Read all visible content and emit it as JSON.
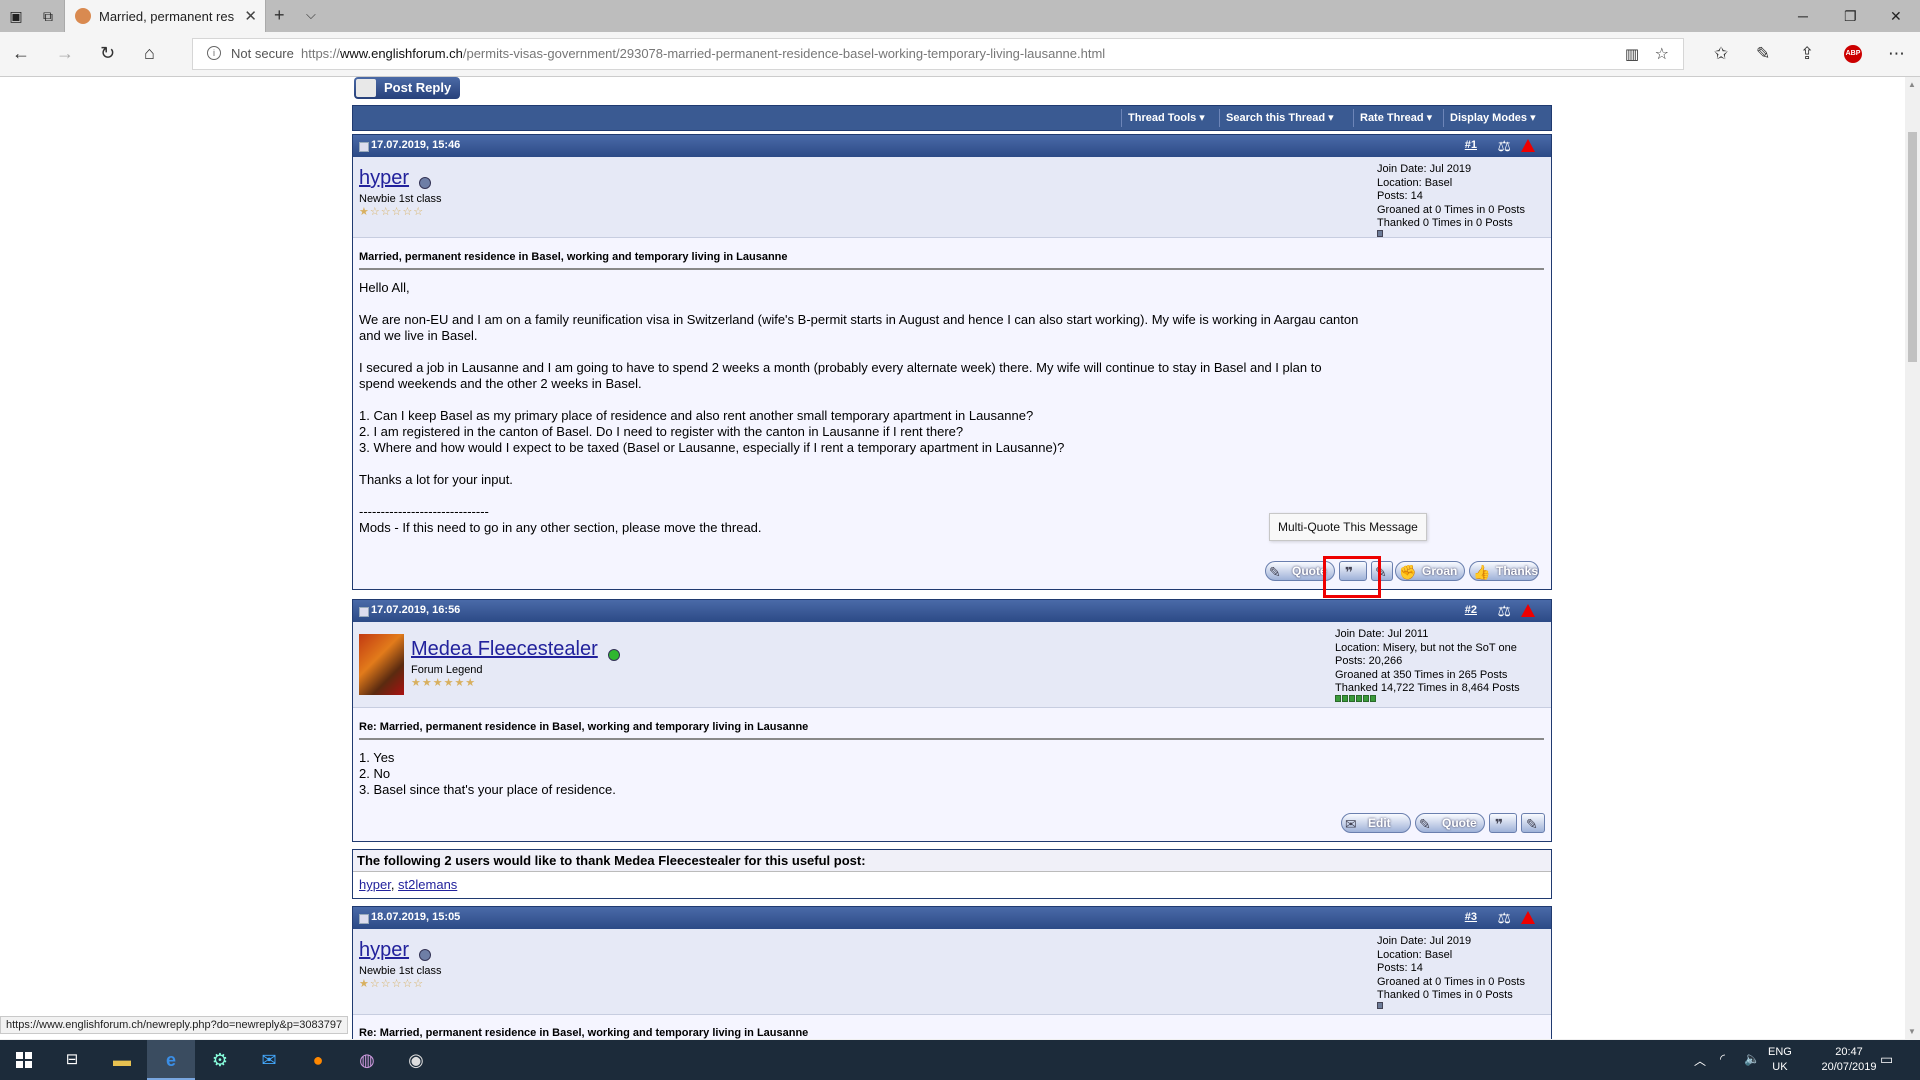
{
  "browser": {
    "tab_title": "Married, permanent res",
    "not_secure": "Not secure",
    "url_prefix": "https://",
    "url_domain": "www.englishforum.ch",
    "url_path": "/permits-visas-government/293078-married-permanent-residence-basel-working-temporary-living-lausanne.html"
  },
  "forum": {
    "post_reply": "Post Reply",
    "toolbar": [
      "Thread Tools ▾",
      "Search this Thread ▾",
      "Rate Thread ▾",
      "Display Modes ▾"
    ],
    "tooltip": "Multi-Quote This Message",
    "posts": [
      {
        "date": "17.07.2019, 15:46",
        "num": "#1",
        "user": "hyper",
        "user_title": "Newbie 1st class",
        "stats": [
          "Join Date: Jul 2019",
          "Location: Basel",
          "Posts: 14",
          "Groaned at 0 Times in 0 Posts",
          "Thanked 0 Times in 0 Posts"
        ],
        "title": "Married, permanent residence in Basel, working and temporary living in Lausanne",
        "paragraphs": [
          [
            "Hello All,"
          ],
          [
            "We are non-EU and I am on a family reunification visa in Switzerland (wife's B-permit starts in August and hence I can also start working). My wife is working in Aargau canton",
            "and we live in Basel."
          ],
          [
            "I secured a job in Lausanne and I am going to have to spend 2 weeks a month (probably every alternate week) there. My wife will continue to stay in Basel and I plan to",
            "spend weekends and the other 2 weeks in Basel."
          ],
          [
            "1. Can I keep Basel as my primary place of residence and also rent another small temporary apartment in Lausanne?",
            "2. I am registered in the canton of Basel. Do I need to register with the canton in Lausanne if I rent there?",
            "3. Where and how would I expect to be taxed (Basel or Lausanne, especially if I rent a temporary apartment in Lausanne)?"
          ],
          [
            "Thanks a lot for your input."
          ],
          [
            "------------------------------",
            "Mods - If this need to go in any other section, please move the thread."
          ]
        ],
        "buttons": {
          "quote": "Quote",
          "groan": "Groan",
          "thanks": "Thanks"
        }
      },
      {
        "date": "17.07.2019, 16:56",
        "num": "#2",
        "user": "Medea Fleecestealer",
        "user_title": "Forum Legend",
        "stats": [
          "Join Date: Jul 2011",
          "Location: Misery, but not the SoT one",
          "Posts: 20,266",
          "Groaned at 350 Times in 265 Posts",
          "Thanked 14,722 Times in 8,464 Posts"
        ],
        "title": "Re: Married, permanent residence in Basel, working and temporary living in Lausanne",
        "lines": [
          "1. Yes",
          "2. No",
          "3. Basel since that's your place of residence."
        ],
        "buttons": {
          "edit": "Edit",
          "quote": "Quote"
        }
      },
      {
        "date": "18.07.2019, 15:05",
        "num": "#3",
        "user": "hyper",
        "user_title": "Newbie 1st class",
        "stats": [
          "Join Date: Jul 2019",
          "Location: Basel",
          "Posts: 14",
          "Groaned at 0 Times in 0 Posts",
          "Thanked 0 Times in 0 Posts"
        ],
        "title": "Re: Married, permanent residence in Basel, working and temporary living in Lausanne"
      }
    ],
    "thanks": {
      "text": "The following 2 users would like to thank Medea Fleecestealer for this useful post:",
      "users": [
        "hyper",
        "st2lemans"
      ]
    }
  },
  "status_url": "https://www.englishforum.ch/newreply.php?do=newreply&p=3083797",
  "taskbar": {
    "lang1": "ENG",
    "lang2": "UK",
    "time": "20:47",
    "date": "20/07/2019"
  }
}
